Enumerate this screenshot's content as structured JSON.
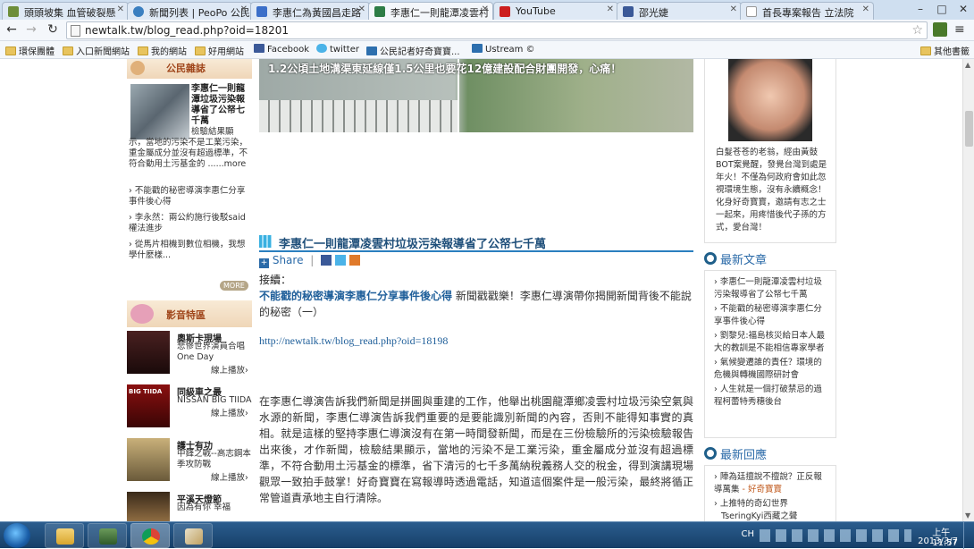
{
  "browser": {
    "tabs": [
      {
        "title": "頭頭坡集 血管破裂懸"
      },
      {
        "title": "新聞列表 | PeoPo 公民"
      },
      {
        "title": "李惠仁為黃國昌走路"
      },
      {
        "title": "李惠仁一則龍潭凌雲村"
      },
      {
        "title": "YouTube"
      },
      {
        "title": "邵光婕"
      },
      {
        "title": "首長專案報告 立法院"
      }
    ],
    "url": "newtalk.tw/blog_read.php?oid=18201",
    "bookmarks": [
      "環保團體",
      "入口新聞網站",
      "我的網站",
      "好用網站",
      "Facebook",
      "twitter",
      "公民記者好奇寶寶...",
      "Ustream ©",
      "其他書籤"
    ]
  },
  "left": {
    "section_title": "公民雜誌",
    "feature": {
      "title": "李惠仁一則龍潭垃圾污染報導省了公帑七千萬",
      "body": "檢驗結果顯示，當地的污染不是工業污染，重金屬成分並沒有超過標準，不符合動用土污基金的 ......more"
    },
    "links": [
      "不能戳的秘密導演李惠仁分享事件後心得",
      "李永然：兩公約施行後駁said權法進步",
      "從馬片相機到數位相機，我想學什麼樣..."
    ],
    "more": "MORE",
    "video_title": "影音特區",
    "videos": [
      {
        "title": "奧斯卡現場",
        "desc": "悲慘世界演員合唱One Day",
        "play": "線上播放›"
      },
      {
        "title": "同級車之最",
        "desc": "NISSAN BIG TIIDA",
        "play": "線上播放›"
      },
      {
        "title": "護士有功",
        "desc": "中鋒之戰--高志鋼本季攻防戰",
        "play": "線上播放›"
      },
      {
        "title": "平溪天燈節",
        "desc": "因為有你 幸福",
        "play": ""
      }
    ],
    "video_thumb_texts": [
      "",
      "BIG TIIDA",
      "",
      ""
    ]
  },
  "center": {
    "banner_text": "1.2公頃土地溝渠東延線僅1.5公里也要花12億建設配合財團開發，心痛！",
    "article_title": "李惠仁一則龍潭凌雲村垃圾污染報導省了公帑七千萬",
    "share_label": "Share",
    "intro_label": "接續：",
    "link_title": "不能戳的秘密導演李惠仁分享事件後心得",
    "link_suffix": "新聞戳戳樂！李惠仁導演帶你揭開新聞背後不能說的秘密（一）",
    "link_url": "http://newtalk.tw/blog_read.php?oid=18198",
    "paragraph": "在李惠仁導演告訴我們新聞是拼圖與重建的工作，他舉出桃園龍潭鄉凌雲村垃圾污染空氣與水源的新聞，李惠仁導演告訴我們重要的是要能識別新聞的內容，否則不能得知事實的真相。就是這樣的堅持李惠仁導演沒有在第一時間發新聞，而是在三份檢驗所的污染檢驗報告出來後，才作新聞，檢驗結果顯示，當地的污染不是工業污染，重金屬成分並沒有超過標準，不符合動用土污基金的標準，省下清污的七千多萬納稅義務人交的稅金，得到演講現場觀眾一致拍手鼓掌！好奇寶寶在寫報導時透過電話，知道這個案件是一般污染，最終將循正常管道責承地主自行清除。"
  },
  "right": {
    "profile_text": "白髮苍苍的老翁，經由黃鼓BOT案覺醒，發覺台灣到處是年火！不僅為何政府會如此忽視環境生態，沒有永續概念！化身好奇寶寶，邀請有志之士一起來，用疼惜後代子孫的方式，愛台灣！",
    "latest_title": "最新文章",
    "latest": [
      "李惠仁一則龍潭凌雲村垃圾污染報導省了公帑七千萬",
      "不能戳的秘密導演李惠仁分享事件後心得",
      "劉黎兒:福島核災給日本人最大的教訓是不能相信專家學者",
      "氣候變遷誰的責任？環境的危機與轉機國際研討會",
      "人生就是一個打破禁忌的過程柯蕾特秀穗後台"
    ],
    "reply_title": "最新回應",
    "replies": [
      {
        "text": "陣為廷擅說不擅說？正反報導萬集",
        "author": "- 好奇寶寶"
      },
      {
        "text": "上推特的奇幻世界",
        "author": "TseringKyi西藏之聲"
      }
    ]
  },
  "taskbar": {
    "lang": "CH",
    "time": "上午 11:57",
    "date": "2013/3/7"
  },
  "colors": {
    "link_blue": "#1f5f9a",
    "title_blue": "#2a6aa8",
    "accent_orange": "#c0581b",
    "section_green": "#2f6f8f"
  }
}
